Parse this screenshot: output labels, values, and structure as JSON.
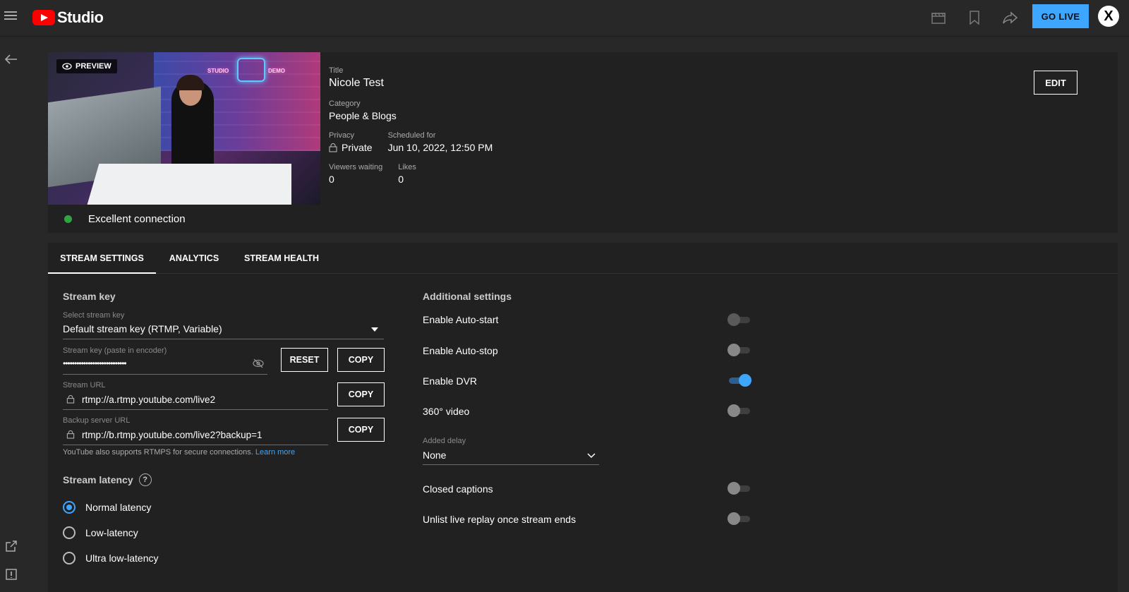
{
  "topbar": {
    "brand": "Studio",
    "go_live_label": "GO LIVE",
    "avatar_letter": "X"
  },
  "preview": {
    "chip_label": "PREVIEW",
    "neon_left": "STUDIO",
    "neon_right": "DEMO"
  },
  "stream_info": {
    "title_label": "Title",
    "title": "Nicole Test",
    "category_label": "Category",
    "category": "People & Blogs",
    "privacy_label": "Privacy",
    "privacy": "Private",
    "scheduled_label": "Scheduled for",
    "scheduled": "Jun 10, 2022, 12:50 PM",
    "viewers_label": "Viewers waiting",
    "viewers": "0",
    "likes_label": "Likes",
    "likes": "0",
    "edit_label": "EDIT"
  },
  "connection": {
    "status": "Excellent connection",
    "color": "#2ba640"
  },
  "tabs": [
    {
      "label": "STREAM SETTINGS",
      "active": true
    },
    {
      "label": "ANALYTICS",
      "active": false
    },
    {
      "label": "STREAM HEALTH",
      "active": false
    }
  ],
  "stream_key": {
    "section_title": "Stream key",
    "select_label": "Select stream key",
    "select_value": "Default stream key (RTMP, Variable)",
    "key_label": "Stream key (paste in encoder)",
    "key_masked": "••••••••••••••••••••••••••••",
    "reset_label": "RESET",
    "copy_label": "COPY",
    "url_label": "Stream URL",
    "url_value": "rtmp://a.rtmp.youtube.com/live2",
    "backup_label": "Backup server URL",
    "backup_value": "rtmp://b.rtmp.youtube.com/live2?backup=1",
    "help_text": "YouTube also supports RTMPS for secure connections.",
    "help_link": "Learn more"
  },
  "latency": {
    "title": "Stream latency",
    "help_icon": "?",
    "options": [
      {
        "label": "Normal latency",
        "selected": true
      },
      {
        "label": "Low-latency",
        "selected": false
      },
      {
        "label": "Ultra low-latency",
        "selected": false
      }
    ]
  },
  "additional": {
    "title": "Additional settings",
    "toggles": [
      {
        "label": "Enable Auto-start",
        "on": false,
        "disabled": true
      },
      {
        "label": "Enable Auto-stop",
        "on": false,
        "disabled": false
      },
      {
        "label": "Enable DVR",
        "on": true,
        "disabled": false
      },
      {
        "label": "360° video",
        "on": false,
        "disabled": false
      }
    ],
    "delay_label": "Added delay",
    "delay_value": "None",
    "toggles2": [
      {
        "label": "Closed captions",
        "on": false,
        "disabled": false
      },
      {
        "label": "Unlist live replay once stream ends",
        "on": false,
        "disabled": false
      }
    ]
  },
  "colors": {
    "accent": "#3ea6ff",
    "brand_red": "#ff0000",
    "bg": "#282828",
    "panel": "#212121"
  }
}
